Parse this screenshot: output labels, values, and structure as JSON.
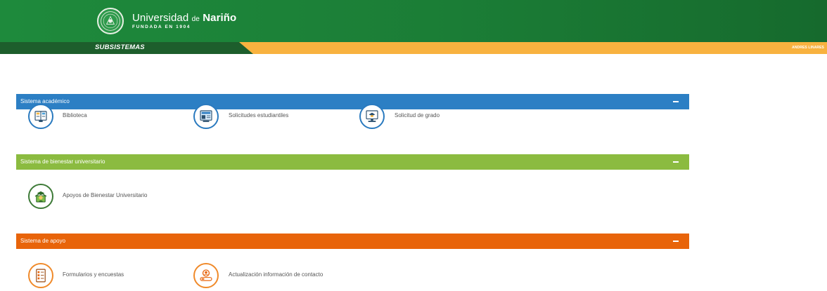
{
  "header": {
    "university_name_part1": "Universidad",
    "university_name_de": "de",
    "university_name_part2": "Nariño",
    "founded": "FUNDADA EN 1904",
    "logo_icon": "university-seal-icon"
  },
  "subbar": {
    "title": "SUBSISTEMAS",
    "user": "ANDRES LINARES"
  },
  "colors": {
    "header_green": "#1b7d36",
    "subbar_dark_green": "#1d5e2c",
    "subbar_yellow": "#f8b23f",
    "academic_blue": "#2c7fc4",
    "welfare_green": "#8bbb40",
    "support_orange": "#e8640a"
  },
  "sections": [
    {
      "title": "Sistema académico",
      "collapse_label": "–",
      "items": [
        {
          "label": "Biblioteca",
          "icon": "library-book-icon"
        },
        {
          "label": "Solicitudes estudiantiles",
          "icon": "student-requests-icon"
        },
        {
          "label": "Solicitud de grado",
          "icon": "graduation-monitor-icon"
        }
      ]
    },
    {
      "title": "Sistema de bienestar universitario",
      "collapse_label": "–",
      "items": [
        {
          "label": "Apoyos de Bienestar Universitario",
          "icon": "graduate-support-icon"
        }
      ]
    },
    {
      "title": "Sistema de apoyo",
      "collapse_label": "–",
      "items": [
        {
          "label": "Formularios y encuestas",
          "icon": "form-survey-icon"
        },
        {
          "label": "Actualización información de contacto",
          "icon": "contact-update-icon"
        }
      ]
    }
  ]
}
